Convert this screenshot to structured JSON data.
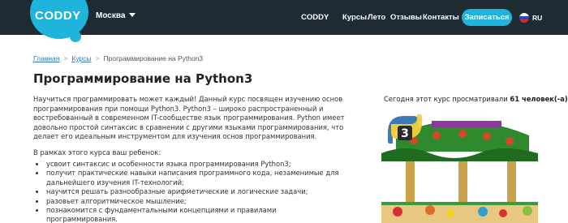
{
  "header": {
    "logo": "CODDY",
    "city": "Москва",
    "nav": [
      "CODDY",
      "Курсы",
      "Лето",
      "Отзывы",
      "Контакты"
    ],
    "signup_label": "Записаться",
    "language": "RU"
  },
  "breadcrumb": {
    "home": "Главная",
    "courses": "Курсы",
    "current": "Программирование на Python3"
  },
  "page": {
    "title": "Программирование на Python3",
    "description": "Научиться программировать может каждый! Данный курс посвящен изучению основ программирования при помощи Python3. Python3 – широко распространенный и востребованный в современном IT-сообществе язык программирования. Python имеет довольно простой синтаксис в сравнении с другими языками программирования, что делает его идеальным инструментом для изучения основ программирования.",
    "goals_intro": "В рамках этого курса ваш ребенок:",
    "goals": [
      "усвоит синтаксис и особенности языка программирования Python3;",
      "получит практические навыки написания программного кода, незаменимые для дальнейшего изучения IT-технологий;",
      "научится решать разнообразные арифметические и логические задачи;",
      "разовьет алгоритмическое мышление;",
      "познакомится с фундаментальными концепциями и правилами программирования."
    ]
  },
  "sidebar": {
    "views_prefix": "Сегодня этот курс просматривали",
    "views_count": "61 человек(-а)",
    "image_badge": "3"
  },
  "colors": {
    "header_bg": "#1e2b33",
    "accent": "#1fb4dc",
    "link": "#2a78b8"
  }
}
